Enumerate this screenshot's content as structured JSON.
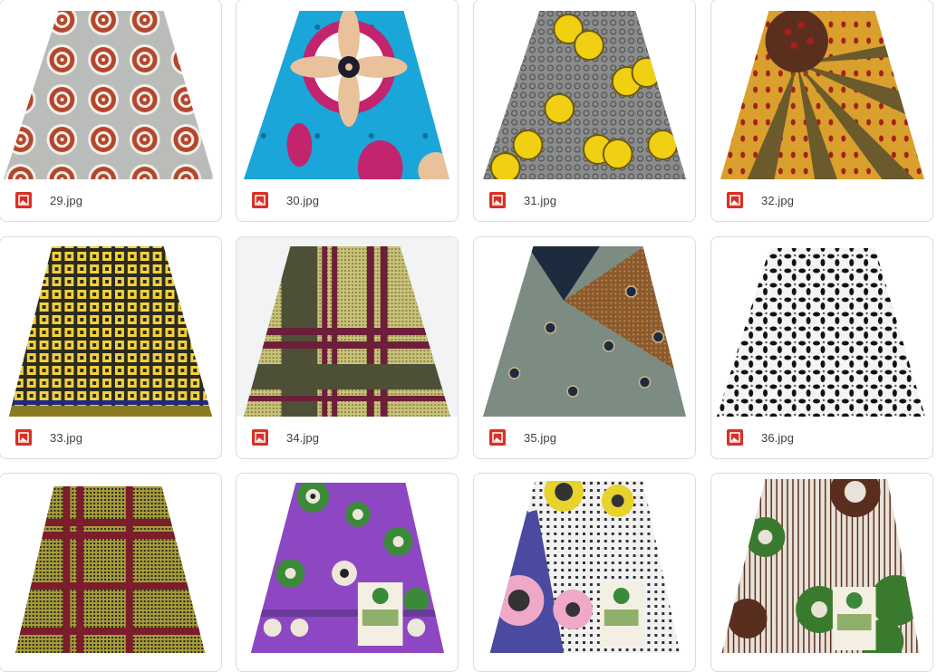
{
  "files": [
    {
      "name": "29.jpg",
      "icon": "image-file-icon",
      "colors": {
        "base": "#b9bcb8",
        "accent": "#b5462d",
        "detail": "#f2f0ea"
      },
      "pattern": "rings"
    },
    {
      "name": "30.jpg",
      "icon": "image-file-icon",
      "colors": {
        "base": "#1aa6d8",
        "accent": "#c2246e",
        "detail": "#e9c29c"
      },
      "pattern": "flower"
    },
    {
      "name": "31.jpg",
      "icon": "image-file-icon",
      "colors": {
        "base": "#8a8d8c",
        "accent": "#f1cf12",
        "detail": "#4a4a4a"
      },
      "pattern": "coins"
    },
    {
      "name": "32.jpg",
      "icon": "image-file-icon",
      "colors": {
        "base": "#d9a02d",
        "accent": "#6a5a2c",
        "detail": "#a51f1b"
      },
      "pattern": "rays"
    },
    {
      "name": "33.jpg",
      "icon": "image-file-icon",
      "colors": {
        "base": "#2b2b21",
        "accent": "#f2d13a",
        "detail": "#1e2a80"
      },
      "pattern": "squares"
    },
    {
      "name": "34.jpg",
      "icon": "image-file-icon",
      "colors": {
        "base": "#c9c27a",
        "accent": "#6d1f3a",
        "detail": "#4d4f37"
      },
      "pattern": "plaid"
    },
    {
      "name": "35.jpg",
      "icon": "image-file-icon",
      "colors": {
        "base": "#7c8c83",
        "accent": "#8a5a2e",
        "detail": "#1d2b3e"
      },
      "pattern": "split"
    },
    {
      "name": "36.jpg",
      "icon": "image-file-icon",
      "colors": {
        "base": "#f4f4f4",
        "accent": "#111111",
        "detail": "#555555"
      },
      "pattern": "floral"
    },
    {
      "name": "",
      "icon": "image-file-icon",
      "colors": {
        "base": "#a69b3a",
        "accent": "#7b1d2b",
        "detail": "#2b2b1c"
      },
      "pattern": "plaid2"
    },
    {
      "name": "",
      "icon": "image-file-icon",
      "colors": {
        "base": "#8e47c2",
        "accent": "#3a8a3a",
        "detail": "#ece7d8"
      },
      "pattern": "bubbles"
    },
    {
      "name": "",
      "icon": "image-file-icon",
      "colors": {
        "base": "#4a4aa0",
        "accent": "#f0a8c8",
        "detail": "#e8d22c"
      },
      "pattern": "pinkdots"
    },
    {
      "name": "",
      "icon": "image-file-icon",
      "colors": {
        "base": "#e8e2d9",
        "accent": "#3a7a2e",
        "detail": "#5a2e1e"
      },
      "pattern": "greenflowers"
    }
  ]
}
